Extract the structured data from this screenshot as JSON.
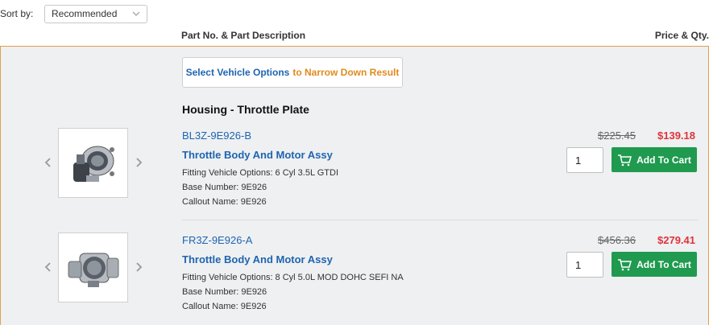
{
  "sort": {
    "label": "Sort by:",
    "selected": "Recommended"
  },
  "columns": {
    "left": "Part No. & Part Description",
    "right": "Price & Qty."
  },
  "vehicle_button": {
    "part1": "Select Vehicle Options",
    "part2": "to Narrow Down Result"
  },
  "group_title": "Housing - Throttle Plate",
  "colors": {
    "link": "#1f64b0",
    "accent_orange": "#e08a1e",
    "sale_red": "#e0333a",
    "cart_green": "#1f9a4f",
    "panel_border": "#e0a04a"
  },
  "parts": [
    {
      "part_no": "BL3Z-9E926-B",
      "description": "Throttle Body And Motor Assy",
      "fitting": "Fitting Vehicle Options: 6 Cyl 3.5L GTDI",
      "base": "Base Number: 9E926",
      "callout": "Callout Name: 9E926",
      "old_price": "$225.45",
      "price": "$139.18",
      "qty": "1",
      "cart_label": "Add To Cart",
      "icon": "throttle-body-image"
    },
    {
      "part_no": "FR3Z-9E926-A",
      "description": "Throttle Body And Motor Assy",
      "fitting": "Fitting Vehicle Options: 8 Cyl 5.0L MOD DOHC SEFI NA",
      "base": "Base Number: 9E926",
      "callout": "Callout Name: 9E926",
      "old_price": "$456.36",
      "price": "$279.41",
      "qty": "1",
      "cart_label": "Add To Cart",
      "icon": "throttle-body-image"
    }
  ]
}
